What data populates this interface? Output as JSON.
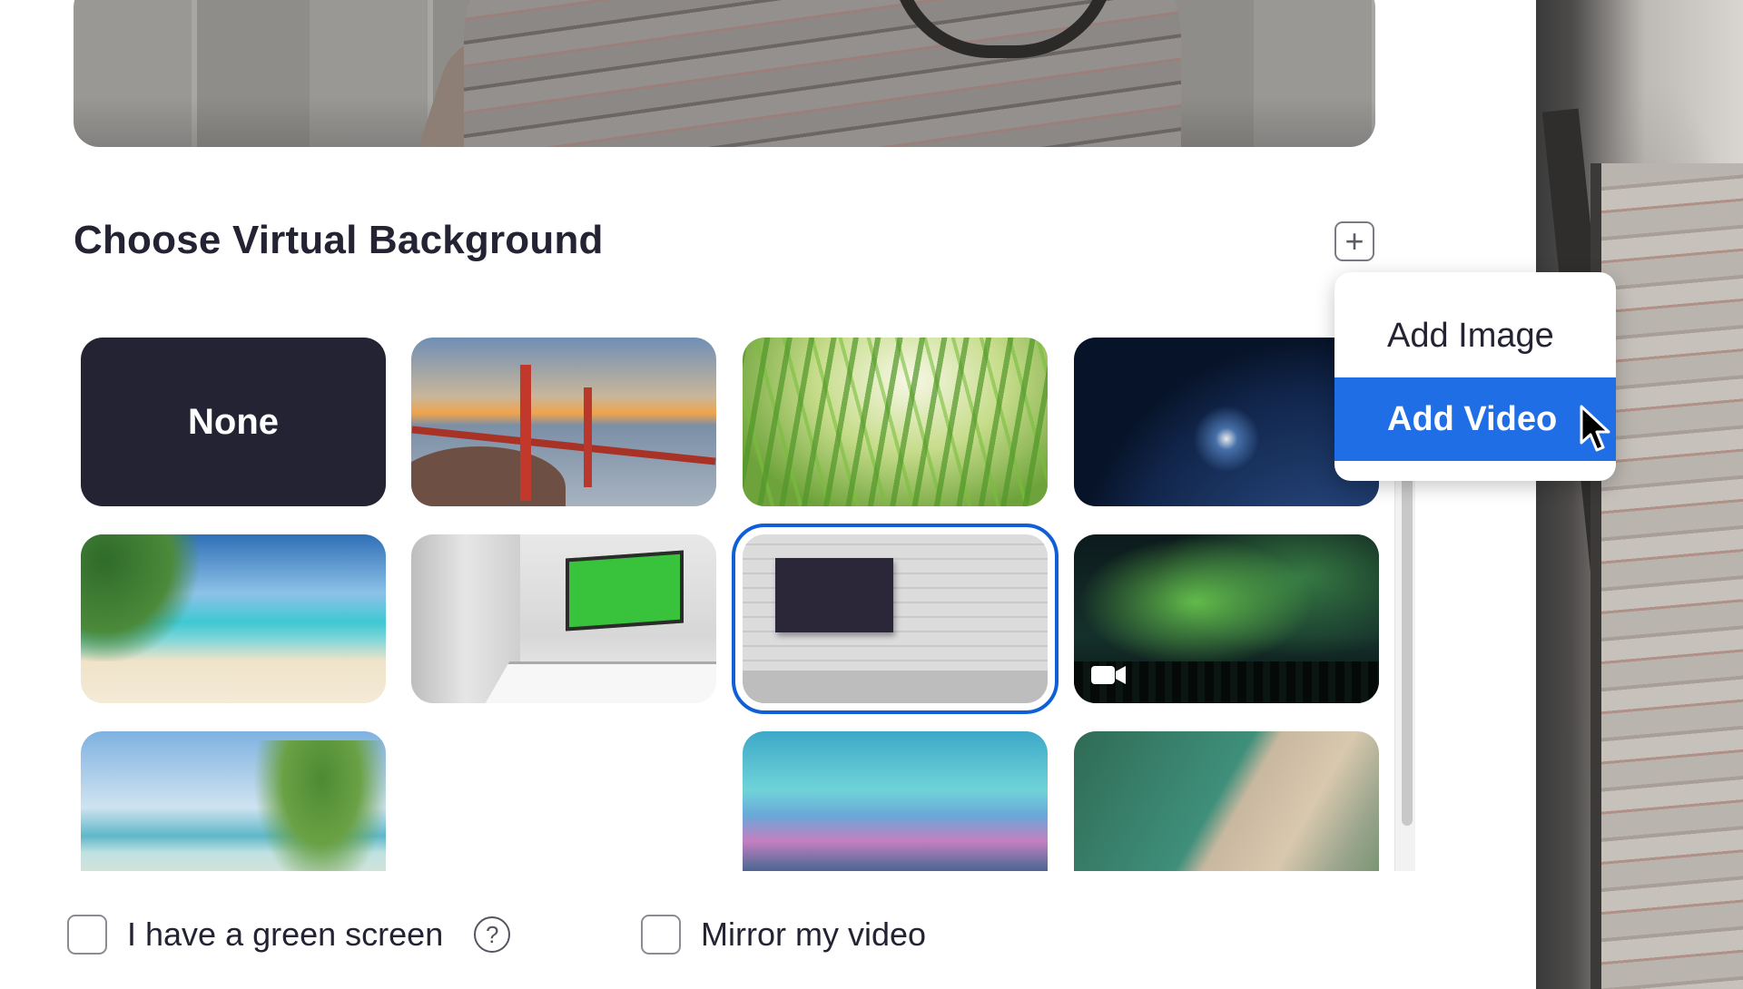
{
  "section": {
    "title": "Choose Virtual Background"
  },
  "add_menu": {
    "items": [
      {
        "label": "Add Image"
      },
      {
        "label": "Add Video",
        "highlighted": true
      }
    ]
  },
  "backgrounds": [
    {
      "label": "None",
      "kind": "none"
    },
    {
      "kind": "image",
      "theme": "golden-gate-bridge"
    },
    {
      "kind": "image",
      "theme": "grass"
    },
    {
      "kind": "image",
      "theme": "earth-from-space"
    },
    {
      "kind": "image",
      "theme": "tropical-beach"
    },
    {
      "kind": "image",
      "theme": "office-green-screen"
    },
    {
      "kind": "image",
      "theme": "brick-wall-sign",
      "selected": true
    },
    {
      "kind": "video",
      "theme": "aurora"
    },
    {
      "kind": "image",
      "theme": "palm-beach"
    },
    {
      "kind": "blank"
    },
    {
      "kind": "video",
      "theme": "sunset-sky"
    },
    {
      "kind": "video",
      "theme": "coastline"
    }
  ],
  "options": {
    "green_screen_label": "I have a green screen",
    "mirror_label": "Mirror my video",
    "help_glyph": "?"
  },
  "colors": {
    "accent": "#1f6ee6",
    "selected_outline": "#0e5fd8",
    "none_tile": "#232333"
  }
}
